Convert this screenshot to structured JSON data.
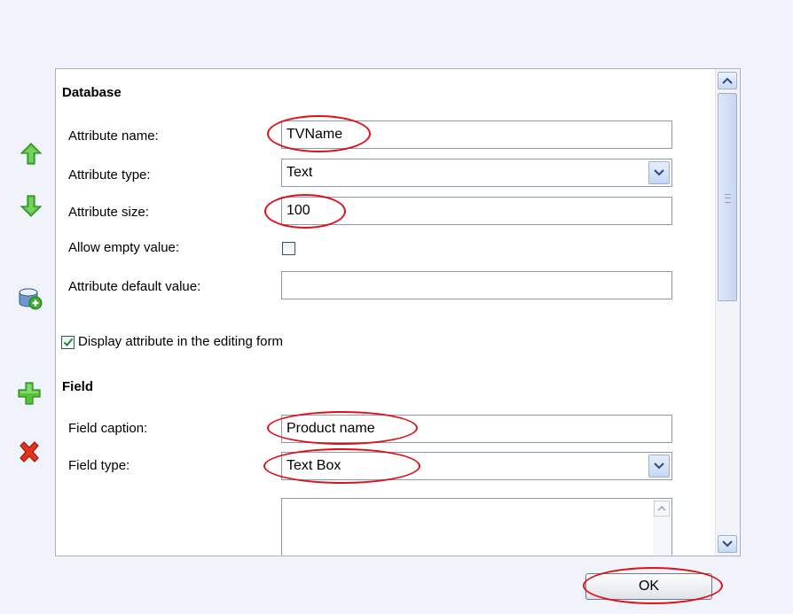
{
  "toolbar": {
    "icons": [
      "move-up-icon",
      "move-down-icon",
      "new-attribute-from-db-icon",
      "add-icon",
      "delete-icon"
    ],
    "colors": {
      "arrow_green": "#3da82b",
      "delete_red": "#d8261a"
    }
  },
  "database": {
    "title": "Database",
    "attribute_name_label": "Attribute name:",
    "attribute_name_value": "TVName",
    "attribute_type_label": "Attribute type:",
    "attribute_type_value": "Text",
    "attribute_size_label": "Attribute size:",
    "attribute_size_value": "100",
    "allow_empty_label": "Allow empty value:",
    "allow_empty_checked": false,
    "default_value_label": "Attribute default value:",
    "default_value": ""
  },
  "display_in_form": {
    "label": "Display attribute in the editing form",
    "checked": true
  },
  "field": {
    "title": "Field",
    "caption_label": "Field caption:",
    "caption_value": "Product name",
    "type_label": "Field type:",
    "type_value": "Text Box",
    "description_value": ""
  },
  "buttons": {
    "ok_label": "OK"
  },
  "highlight_color": "#e01018"
}
